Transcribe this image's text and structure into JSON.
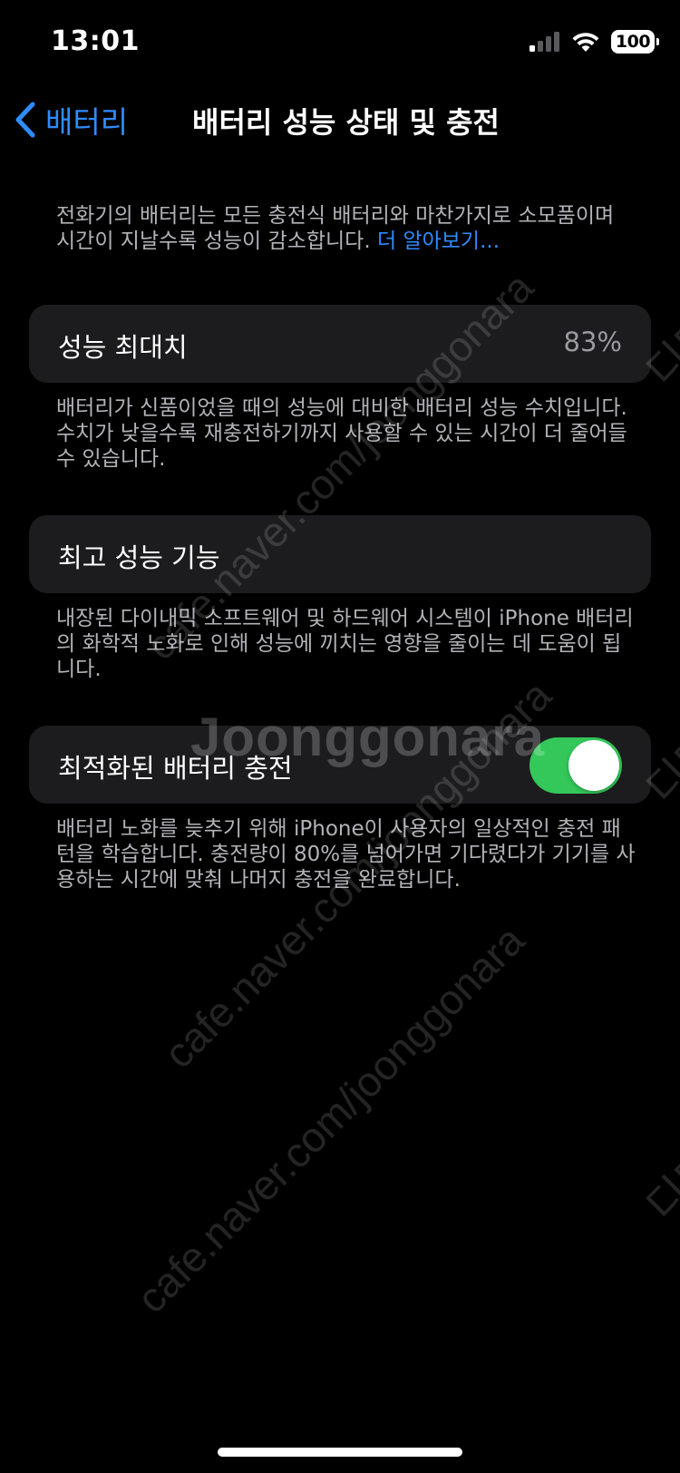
{
  "status_bar": {
    "time": "13:01",
    "battery_level": "100",
    "icons": [
      "cellular-signal-icon",
      "wifi-icon",
      "battery-icon"
    ]
  },
  "nav": {
    "back_label": "배터리",
    "title": "배터리 성능 상태 및 충전"
  },
  "intro": {
    "text": "전화기의 배터리는 모든 충전식 배터리와 마찬가지로 소모품이며 시간이 지날수록 성능이 감소합니다. ",
    "link": "더 알아보기..."
  },
  "max_capacity": {
    "label": "성능 최대치",
    "value": "83%",
    "footnote": "배터리가 신품이었을 때의 성능에 대비한 배터리 성능 수치입니다. 수치가 낮을수록 재충전하기까지 사용할 수 있는 시간이 더 줄어들 수 있습니다."
  },
  "peak_performance": {
    "label": "최고 성능 기능",
    "footnote": "내장된 다이내믹 소프트웨어 및 하드웨어 시스템이 iPhone 배터리의 화학적 노화로 인해 성능에 끼치는 영향을 줄이는 데 도움이 됩니다."
  },
  "optimized_charging": {
    "label": "최적화된 배터리 충전",
    "enabled": true,
    "footnote": "배터리 노화를 늦추기 위해 iPhone이 사용자의 일상적인 충전 패턴을 학습합니다. 충전량이 80%를 넘어가면 기다렸다가 기기를 사용하는 시간에 맞춰 나머지 충전을 완료합니다."
  },
  "watermark": {
    "url": "cafe.naver.com/joonggonara",
    "brand": "Joonggonara",
    "edge_text": "디디"
  },
  "colors": {
    "background": "#000000",
    "cell_background": "#1c1c1e",
    "accent_blue": "#2f8cff",
    "toggle_on": "#34c759",
    "secondary_text": "#b2b2b8"
  }
}
